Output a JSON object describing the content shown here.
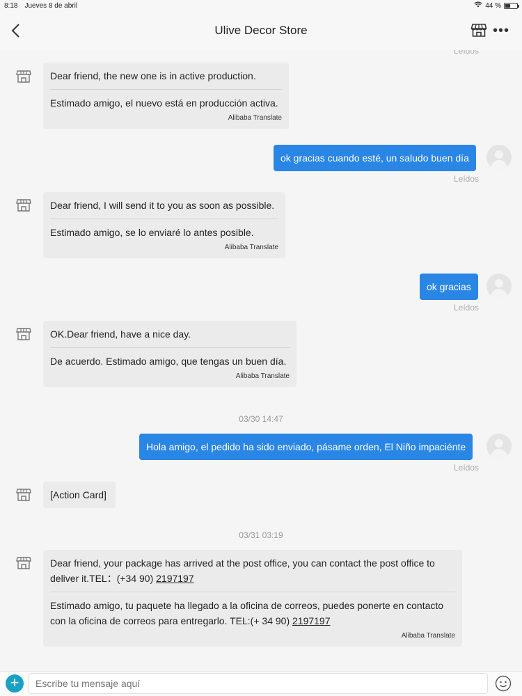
{
  "status": {
    "time": "8:18",
    "date": "Jueves 8 de abril",
    "battery": "44 %",
    "battery_level": 0.44
  },
  "header": {
    "title": "Ulive Decor Store"
  },
  "messages": {
    "read0": "Leídos",
    "in1_en": "Dear friend, the new one is in active production.",
    "in1_es": "Estimado amigo, el nuevo está en producción activa.",
    "in1_tr": "Alibaba Translate",
    "out1": "ok gracias cuando esté, un saludo buen día",
    "read1": "Leídos",
    "in2_en": "Dear friend, I will send it to you as soon as possible.",
    "in2_es": "Estimado amigo, se lo enviaré lo antes posible.",
    "in2_tr": "Alibaba Translate",
    "out2": "ok gracias",
    "read2": "Leídos",
    "in3_en": "OK.Dear friend, have a nice day.",
    "in3_es": "De acuerdo. Estimado amigo, que tengas un buen día.",
    "in3_tr": "Alibaba Translate",
    "ts1": "03/30 14:47",
    "out3": "Hola amigo, el pedido ha sido enviado, pásame orden, El Niño impaciénte",
    "read3": "Leídos",
    "card": "[Action Card]",
    "ts2": "03/31 03:19",
    "in4_en_a": "Dear friend, your package has arrived at the post office, you can contact the post office to",
    "in4_en_b": "deliver it.TEL：(+34 90) ",
    "in4_en_phone": "2197197",
    "in4_es_a": "Estimado amigo, tu paquete ha llegado a la oficina de correos, puedes ponerte en contacto",
    "in4_es_b": "con la oficina de correos para entregarlo. TEL:(+ 34 90) ",
    "in4_es_phone": "2197197",
    "in4_tr": "Alibaba Translate"
  },
  "input": {
    "placeholder": "Escribe tu mensaje aquí"
  },
  "icons": [
    "back-chevron-icon",
    "store-icon",
    "more-icon",
    "store-avatar-icon",
    "user-avatar-icon",
    "plus-icon",
    "emoji-icon",
    "wifi-icon",
    "battery-icon"
  ],
  "colors": {
    "accent": "#2a86e4",
    "bubble_in": "#ebebeb",
    "plus": "#1ba0c5"
  }
}
